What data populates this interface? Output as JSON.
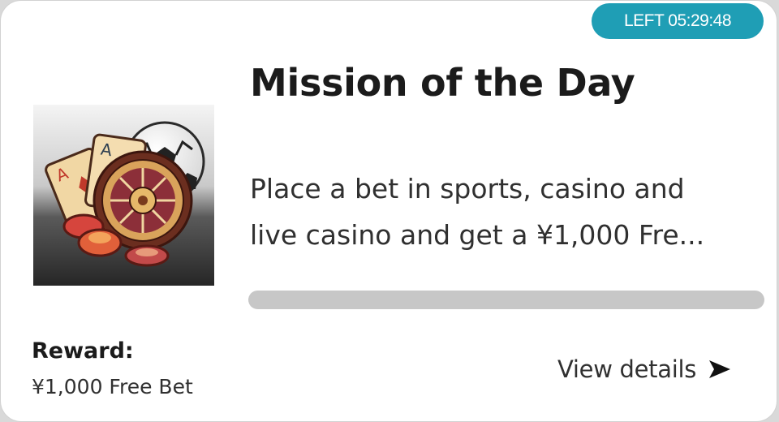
{
  "mission": {
    "timer_text": "LEFT 05:29:48",
    "title": "Mission of the Day",
    "description_line1": "Place a bet in sports, casino and",
    "description_line2": "live casino and get a ¥1,000 Fre...",
    "progress": 0,
    "reward_label": "Reward:",
    "reward_value": "¥1,000 Free Bet",
    "view_details_label": "View details",
    "icons": {
      "thumbnail": "casino-sports-illustration",
      "details_arrow": "arrow-right-icon"
    },
    "colors": {
      "accent": "#1f9eb5",
      "progress_track": "#c7c7c7",
      "text": "#1b1b1b"
    }
  }
}
